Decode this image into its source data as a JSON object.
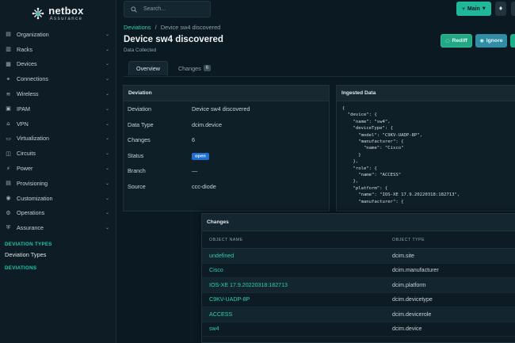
{
  "logo": {
    "name": "netbox",
    "sub": "Assurance"
  },
  "sidebar": {
    "items": [
      {
        "label": "Organization",
        "icon": "building-icon",
        "glyph": "▤"
      },
      {
        "label": "Racks",
        "icon": "rack-icon",
        "glyph": "▥"
      },
      {
        "label": "Devices",
        "icon": "server-icon",
        "glyph": "▦"
      },
      {
        "label": "Connections",
        "icon": "ethernet-icon",
        "glyph": "⚭"
      },
      {
        "label": "Wireless",
        "icon": "wifi-icon",
        "glyph": "≋"
      },
      {
        "label": "IPAM",
        "icon": "counter-icon",
        "glyph": "▣"
      },
      {
        "label": "VPN",
        "icon": "tunnel-icon",
        "glyph": "⌂"
      },
      {
        "label": "Virtualization",
        "icon": "monitor-icon",
        "glyph": "▭"
      },
      {
        "label": "Circuits",
        "icon": "transit-icon",
        "glyph": "◫"
      },
      {
        "label": "Power",
        "icon": "plug-icon",
        "glyph": "⚡"
      },
      {
        "label": "Provisioning",
        "icon": "file-document-icon",
        "glyph": "▤"
      },
      {
        "label": "Customization",
        "icon": "palette-icon",
        "glyph": "◉"
      },
      {
        "label": "Operations",
        "icon": "cogs-icon",
        "glyph": "⚙"
      },
      {
        "label": "Assurance",
        "icon": "shield-icon",
        "glyph": "⛨"
      }
    ],
    "section_deviation_types": "DEVIATION TYPES",
    "deviation_types_link": "Deviation Types",
    "section_deviations": "DEVIATIONS"
  },
  "topbar": {
    "search_placeholder": "Search...",
    "branch_label": "Main"
  },
  "header": {
    "breadcrumb_parent": "Deviations",
    "breadcrumb_sep": "/",
    "breadcrumb_current": "Device sw4 discovered",
    "title": "Device sw4 discovered",
    "subtitle": "Data Collected",
    "rediff_label": "Rediff",
    "ignore_label": "Ignore"
  },
  "tabs": {
    "overview": "Overview",
    "changes": "Changes",
    "changes_count": "6"
  },
  "deviation": {
    "heading": "Deviation",
    "rows": [
      {
        "k": "Deviation",
        "v": "Device sw4 discovered"
      },
      {
        "k": "Data Type",
        "v": "dcim.device"
      },
      {
        "k": "Changes",
        "v": "6"
      },
      {
        "k": "Status",
        "v": "open"
      },
      {
        "k": "Branch",
        "v": "—"
      },
      {
        "k": "Source",
        "v": "ccc-diode"
      }
    ]
  },
  "ingested": {
    "heading": "Ingested Data",
    "code": "{\n  \"device\": {\n    \"name\": \"sw4\",\n    \"deviceType\": {\n      \"model\": \"C9KV-UADP-8P\",\n      \"manufacturer\": {\n        \"name\": \"Cisco\"\n      }\n    },\n    \"role\": {\n      \"name\": \"ACCESS\"\n    },\n    \"platform\": {\n      \"name\": \"IOS-XE 17.9.20220318:182713\",\n      \"manufacturer\": {"
  },
  "changes": {
    "heading": "Changes",
    "col_name": "OBJECT NAME",
    "col_type": "OBJECT TYPE",
    "rows": [
      {
        "name": "undefined",
        "type": "dcim.site"
      },
      {
        "name": "Cisco",
        "type": "dcim.manufacturer"
      },
      {
        "name": "IOS-XE 17.9.20220318:182713",
        "type": "dcim.platform"
      },
      {
        "name": "C9KV-UADP-8P",
        "type": "dcim.devicetype"
      },
      {
        "name": "ACCESS",
        "type": "dcim.devicerole"
      },
      {
        "name": "sw4",
        "type": "dcim.device"
      }
    ]
  }
}
